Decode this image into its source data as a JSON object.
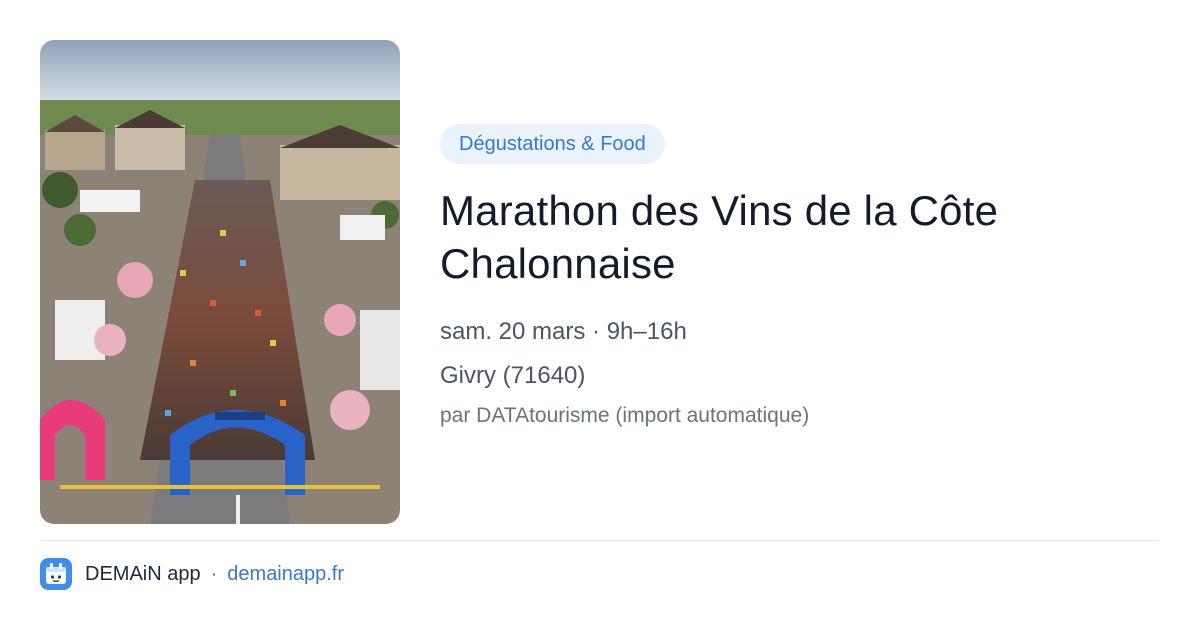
{
  "event": {
    "category": "Dégustations & Food",
    "title": "Marathon des Vins de la Côte Chalonnaise",
    "date_time": "sam. 20 mars · 9h–16h",
    "location": "Givry (71640)",
    "source": "par DATAtourisme (import automatique)",
    "image_icon": "marathon-aerial-photo"
  },
  "footer": {
    "app_name": "DEMAiN app",
    "separator": "·",
    "url": "demainapp.fr",
    "logo_icon": "demain-app-logo-icon"
  },
  "colors": {
    "accent": "#3a79c9",
    "badge_bg": "#eaf2fc",
    "title": "#141c2b",
    "text": "#4b5563",
    "muted": "#6b7280",
    "divider": "#dde3ea"
  }
}
